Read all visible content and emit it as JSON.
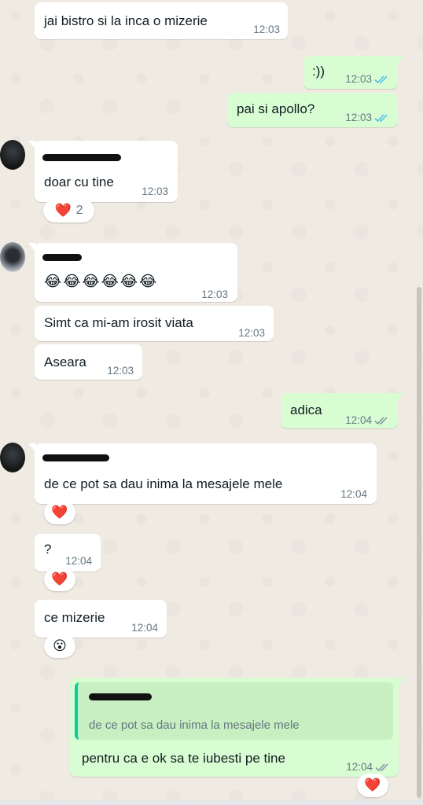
{
  "messages": [
    {
      "text": "jai bistro si la inca o mizerie",
      "time": "12:03"
    },
    {
      "text": ":))",
      "time": "12:03"
    },
    {
      "text": "pai si apollo?",
      "time": "12:03"
    },
    {
      "text": "doar cu tine",
      "time": "12:03",
      "reaction": "❤️",
      "reaction_count": "2"
    },
    {
      "text": "😂😂😂😂😂😂",
      "time": "12:03"
    },
    {
      "text": "Simt ca mi-am irosit viata",
      "time": "12:03"
    },
    {
      "text": "Aseara",
      "time": "12:03"
    },
    {
      "text": "adica",
      "time": "12:04"
    },
    {
      "text": "de ce pot sa dau inima la mesajele mele",
      "time": "12:04",
      "reaction": "❤️"
    },
    {
      "text": "?",
      "time": "12:04",
      "reaction": "❤️"
    },
    {
      "text": "ce mizerie",
      "time": "12:04",
      "reaction": "😮"
    },
    {
      "quoted_text": "de ce pot sa dau inima la mesajele mele",
      "text": "pentru ca e ok sa te iubesti pe tine",
      "time": "12:04",
      "reaction": "❤️"
    }
  ],
  "colors": {
    "background": "#efeae2",
    "incoming": "#ffffff",
    "outgoing": "#d9fdd3",
    "read_ticks": "#53bdeb",
    "delivered_ticks": "#8696a0",
    "quote_bar": "#06cf9c"
  },
  "icons": {
    "read": "double-check-blue-icon",
    "delivered": "double-check-gray-icon"
  }
}
